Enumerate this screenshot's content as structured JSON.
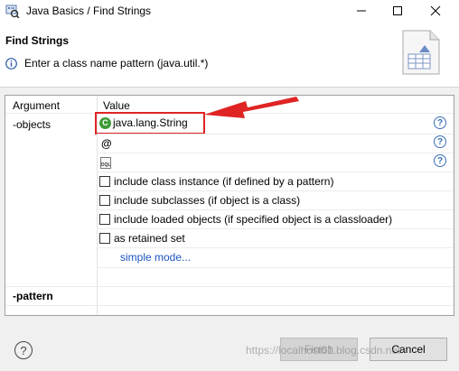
{
  "window": {
    "title": "Java Basics / Find Strings"
  },
  "header": {
    "title": "Find Strings",
    "message": "Enter a class name pattern (java.util.*)"
  },
  "table": {
    "col_argument": "Argument",
    "col_value": "Value",
    "rows": {
      "objects": {
        "argument": "-objects",
        "class_pattern": "java.lang.String",
        "options": [
          {
            "label": "include class instance (if defined by a pattern)",
            "checked": false
          },
          {
            "label": "include subclasses (if object is a class)",
            "checked": false
          },
          {
            "label": "include loaded objects (if specified object is a classloader)",
            "checked": false
          },
          {
            "label": "as retained set",
            "checked": false
          }
        ],
        "mode_link": "simple mode..."
      },
      "pattern": {
        "argument": "-pattern"
      }
    }
  },
  "footer": {
    "finish_label": "Finish",
    "cancel_label": "Cancel"
  },
  "watermark": "https://localhost01.blog.csdn.net",
  "icons": {
    "app": "eclipse-mat-icon",
    "info": "info-icon",
    "class": "class-icon",
    "at": "at-sign-icon",
    "oql": "oql-query-icon",
    "help": "help-icon"
  },
  "colors": {
    "annotation": "#e02424",
    "link": "#1a55c0",
    "class_icon": "#3d9b35"
  }
}
